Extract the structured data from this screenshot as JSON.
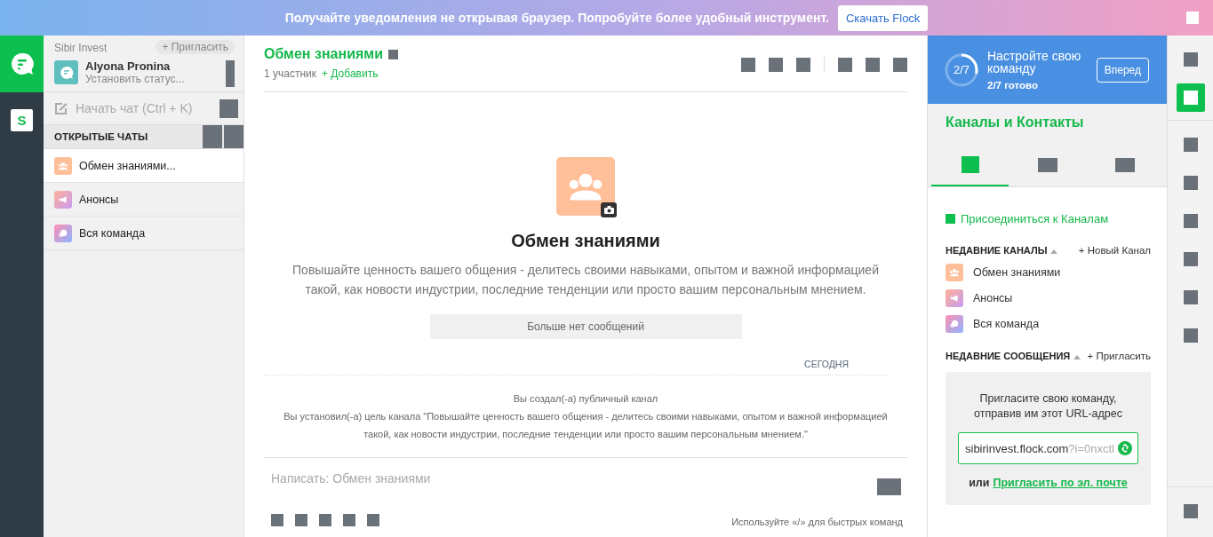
{
  "banner": {
    "text": "Получайте уведомления не открывая браузер. Попробуйте более удобный инструмент.",
    "button": "Скачать Flock"
  },
  "rail": {
    "team_letter": "S"
  },
  "sidebar": {
    "team": "Sibir Invest",
    "invite": "+ Пригласить",
    "user": {
      "name": "Alyona Pronina",
      "status": "Установить статус..."
    },
    "start_chat": "Начать чат (Ctrl + K)",
    "section_title": "ОТКРЫТЫЕ ЧАТЫ",
    "chats": [
      {
        "name": "Обмен знаниями...",
        "kind": "group",
        "selected": true
      },
      {
        "name": "Анонсы",
        "kind": "announce",
        "selected": false
      },
      {
        "name": "Вся команда",
        "kind": "team",
        "selected": false
      }
    ]
  },
  "main": {
    "title": "Обмен знаниями",
    "members": "1 участник",
    "add": "+ Добавить",
    "empty": {
      "title": "Обмен знаниями",
      "description": "Повышайте ценность вашего общения - делитесь своими навыками, опытом и важной информацией такой, как новости индустрии, последние тенденции или просто вашим персональным мнением.",
      "no_more": "Больше нет сообщений"
    },
    "date": "СЕГОДНЯ",
    "events": [
      "Вы создал(-а) публичный канал",
      "Вы установил(-а) цель канала \"Повышайте ценность вашего общения - делитесь своими навыками, опытом и важной информацией такой, как новости индустрии, последние тенденции или просто вашим персональным мнением.\""
    ],
    "composer": {
      "placeholder": "Написать: Обмен знаниями"
    },
    "hint": "Используйте «/» для быстрых команд"
  },
  "panel": {
    "setup": {
      "progress": "2/7",
      "level": 0.2857,
      "title": "Настройте свою команду",
      "done": "2/7 готово",
      "button": "Вперед"
    },
    "title": "Каналы и Контакты",
    "tabs": [
      {
        "selected": true
      },
      {
        "selected": false
      },
      {
        "selected": false
      }
    ],
    "join": "Присоединиться к Каналам",
    "recent_channels": {
      "title": "НЕДАВНИЕ КАНАЛЫ",
      "action": "+ Новый Канал",
      "items": [
        {
          "name": "Обмен знаниями",
          "kind": "group"
        },
        {
          "name": "Анонсы",
          "kind": "announce"
        },
        {
          "name": "Вся команда",
          "kind": "team"
        }
      ]
    },
    "recent_messages": {
      "title": "НЕДАВНИЕ СООБЩЕНИЯ",
      "action": "+ Пригласить"
    },
    "invite_box": {
      "text": "Пригласите свою команду, отправив им этот URL-адрес",
      "url": "sibirinvest.flock.com",
      "url_faded": "?i=0nxctl",
      "or": "или",
      "link": "Пригласить по эл. почте"
    }
  },
  "dock": [
    {
      "selected": false
    },
    {
      "selected": true
    },
    {
      "selected": false
    },
    {
      "selected": false
    },
    {
      "selected": false
    },
    {
      "selected": false
    },
    {
      "selected": false
    },
    {
      "selected": false
    },
    {
      "selected": false
    }
  ]
}
